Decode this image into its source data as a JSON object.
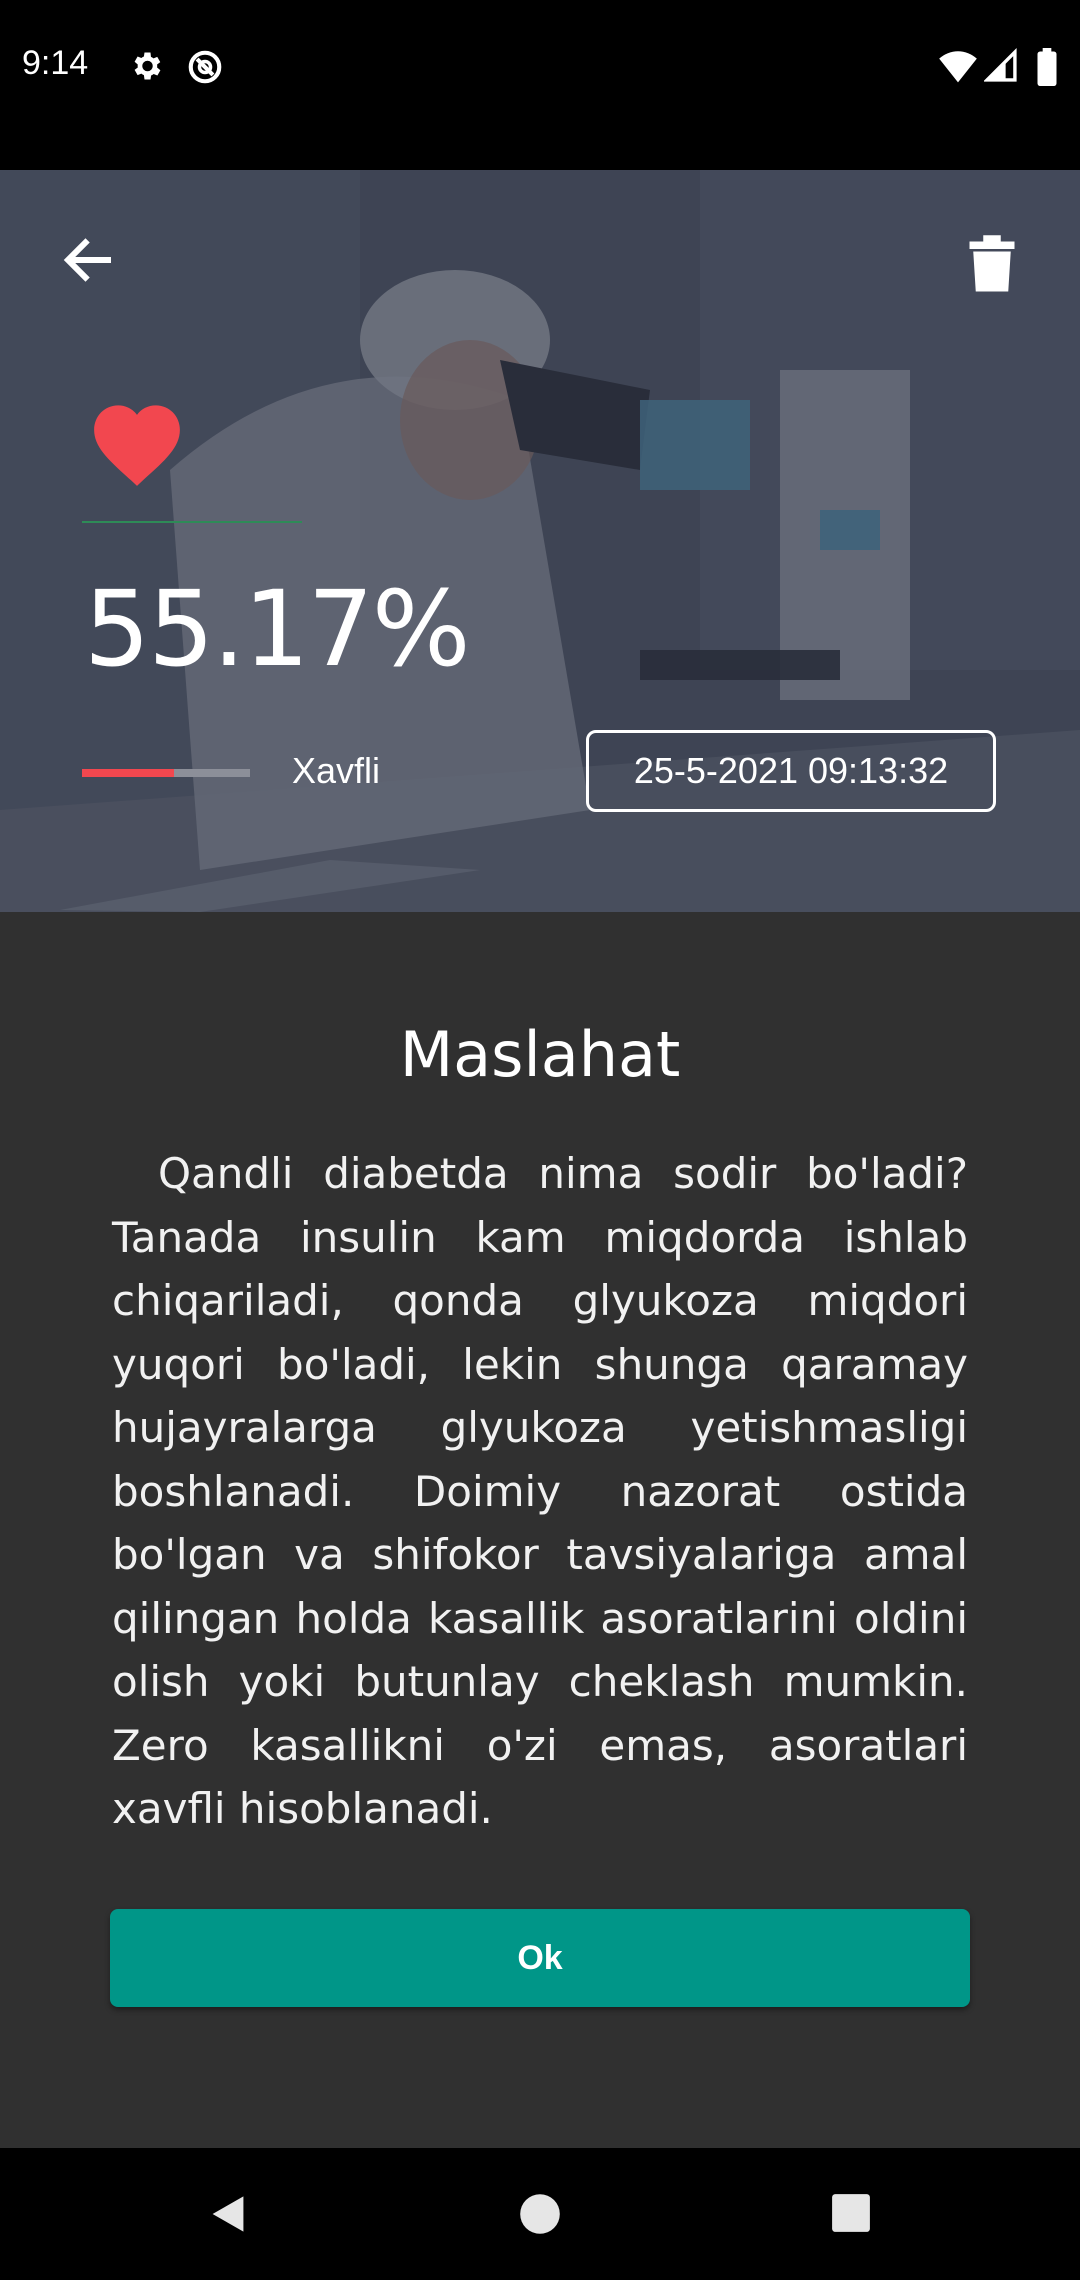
{
  "status_bar": {
    "time": "9:14",
    "icons": [
      "gear-icon",
      "do-not-disturb-icon",
      "wifi-icon",
      "signal-icon",
      "battery-icon"
    ]
  },
  "hero": {
    "icons": [
      "back-arrow-icon",
      "trash-icon",
      "heart-icon"
    ],
    "heart_color": "#f2474f",
    "percent": "55.17%",
    "risk_level": 0.55,
    "risk_color": "#f2474f",
    "risk_label": "Xavfli",
    "datetime": "25-5-2021 09:13:32"
  },
  "panel": {
    "title": "Maslahat",
    "body": "Qandli diabetda nima sodir bo'ladi? Tanada insulin kam miqdorda ishlab chiqariladi, qonda glyukoza miqdori yuqori bo'ladi, lekin shunga qaramay hujayralarga glyukoza yetishmasligi boshlanadi. Doimiy nazorat ostida bo'lgan va shifokor tavsiyalariga amal qilingan holda kasallik asoratlarini oldini olish yoki butunlay cheklash mumkin. Zero kasallikni o'zi emas, asoratlari xavfli hisoblanadi.",
    "ok_label": "Ok",
    "button_color": "#009688"
  },
  "nav_bar": {
    "icons": [
      "back-triangle-icon",
      "home-circle-icon",
      "recents-square-icon"
    ]
  }
}
